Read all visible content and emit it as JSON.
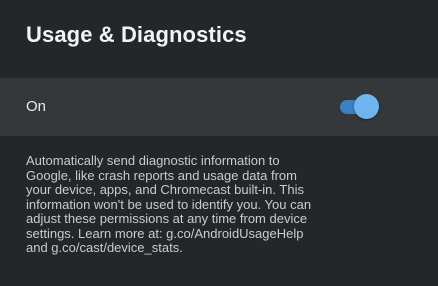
{
  "page": {
    "title": "Usage & Diagnostics"
  },
  "setting": {
    "label": "On",
    "enabled": true,
    "accent_track": "#3d7fc4",
    "accent_thumb": "#6fb4ef"
  },
  "description": {
    "lines": [
      "Automatically send diagnostic information to",
      "Google, like crash reports and usage data from",
      "your device, apps, and Chromecast built-in. This",
      "information won't be used to identify you. You can",
      "adjust these permissions at any time from device",
      "settings. Learn more at: g.co/AndroidUsageHelp",
      "and g.co/cast/device_stats."
    ]
  }
}
